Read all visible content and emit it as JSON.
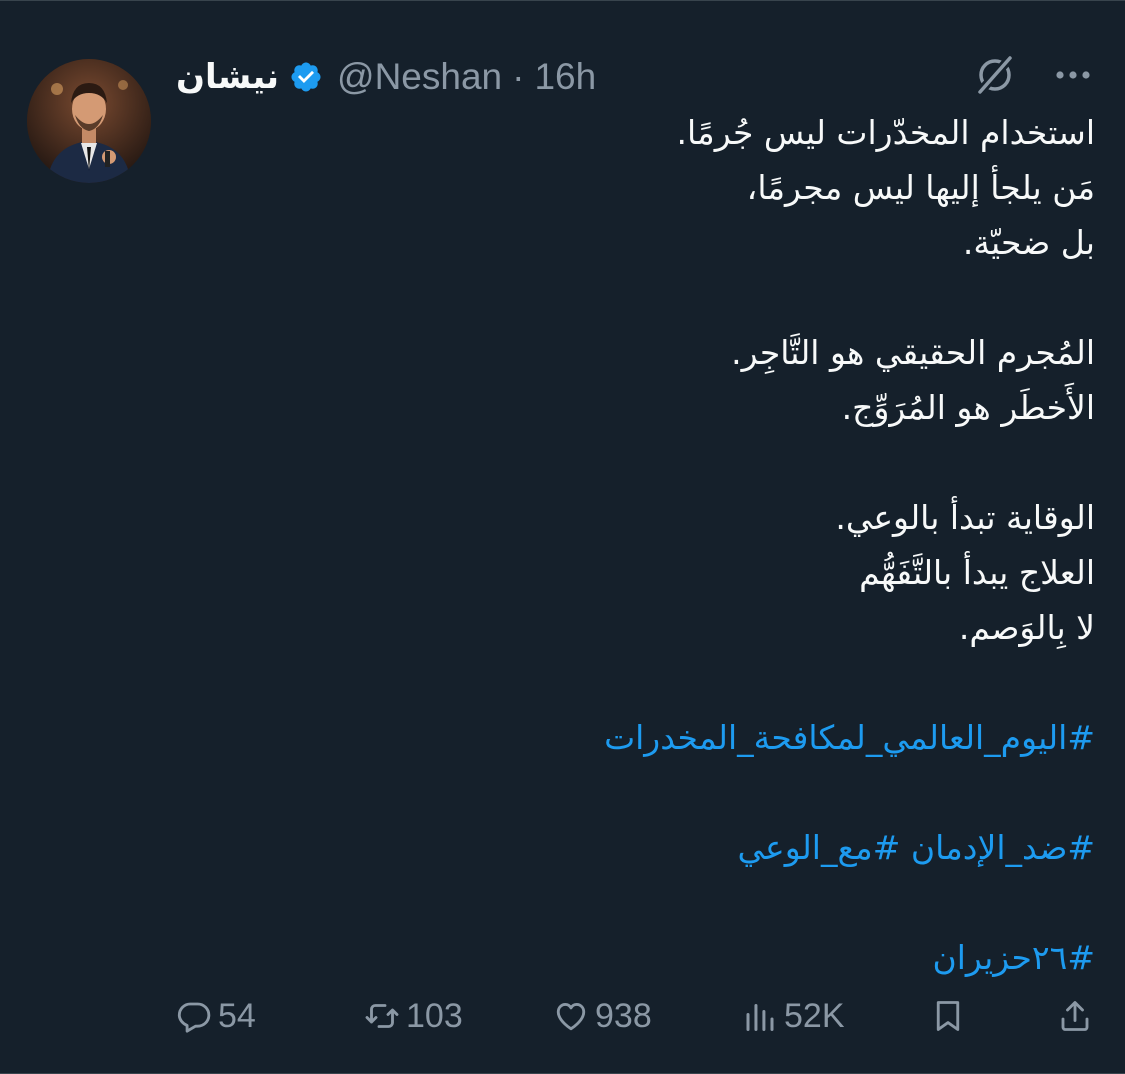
{
  "author": {
    "display_name": "نيشان",
    "handle": "@Neshan",
    "separator": "·",
    "time": "16h"
  },
  "icons": {
    "verified": "verified-badge-icon",
    "grok": "grok-icon",
    "more": "more-options-icon",
    "reply": "reply-icon",
    "retweet": "retweet-icon",
    "like": "like-icon",
    "views": "views-icon",
    "bookmark": "bookmark-icon",
    "share": "share-icon"
  },
  "colors": {
    "background": "#15202b",
    "text": "#f7f9f9",
    "secondary": "#8b98a5",
    "accent": "#1d9bf0"
  },
  "tweet": {
    "lines": [
      "استخدام المخدّرات ليس جُرمًا.",
      "مَن يلجأ إليها ليس مجرمًا،",
      "بل ضحيّة.",
      "المُجرم الحقيقي هو التَّاجِر.",
      "الأَخطَر هو المُرَوِّج.",
      "الوقاية تبدأ بالوعي.",
      "العلاج يبدأ بالتَّفَهُّم",
      "لا بِالوَصم."
    ],
    "hashtags": [
      "#اليوم_العالمي_لمكافحة_المخدرات",
      "#ضد_الإدمان #مع_الوعي",
      "#٢٦حزيران"
    ]
  },
  "stats": {
    "replies": "54",
    "retweets": "103",
    "likes": "938",
    "views": "52K"
  }
}
